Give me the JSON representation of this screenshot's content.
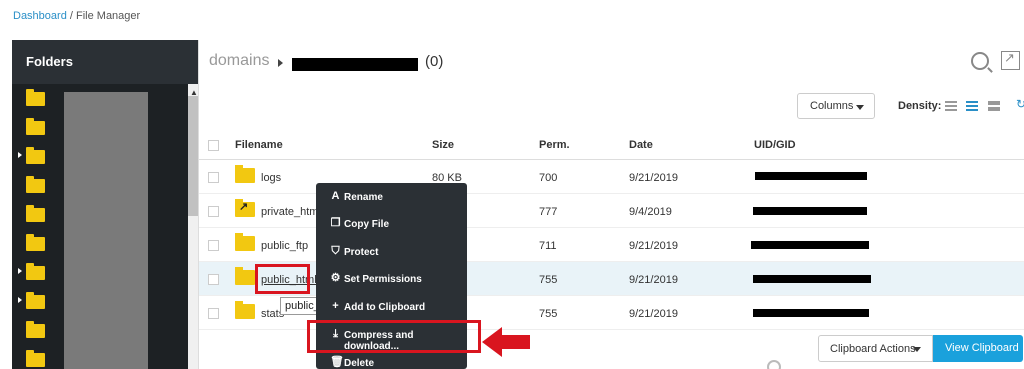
{
  "breadcrumb": {
    "home": "Dashboard",
    "separator": " / ",
    "current": "File Manager"
  },
  "sidebar": {
    "title": "Folders"
  },
  "path": {
    "root": "domains",
    "count": "(0)"
  },
  "toolbar": {
    "columns_label": "Columns",
    "density_label": "Density:"
  },
  "table": {
    "headers": {
      "filename": "Filename",
      "size": "Size",
      "perm": "Perm.",
      "date": "Date",
      "uid": "UID/GID"
    },
    "rows": [
      {
        "name": "logs",
        "size": "80 KB",
        "perm": "700",
        "date": "9/21/2019"
      },
      {
        "name": "private_html",
        "size": "",
        "perm": "777",
        "date": "9/4/2019"
      },
      {
        "name": "public_ftp",
        "size": "",
        "perm": "711",
        "date": "9/21/2019"
      },
      {
        "name": "public_html",
        "size": "",
        "perm": "755",
        "date": "9/21/2019"
      },
      {
        "name": "stats",
        "size": "",
        "perm": "755",
        "date": "9/21/2019"
      }
    ]
  },
  "tooltip": "public_html",
  "context_menu": {
    "items": [
      {
        "label": "Rename",
        "icon": "A"
      },
      {
        "label": "Copy File",
        "icon": "❐"
      },
      {
        "label": "Protect",
        "icon": "⛉"
      },
      {
        "label": "Set Permissions",
        "icon": "⚙"
      },
      {
        "label": "Add to Clipboard",
        "icon": "+"
      },
      {
        "label": "Compress and download...",
        "icon": "⤓"
      },
      {
        "label": "Delete",
        "icon": "🗑"
      }
    ]
  },
  "footer": {
    "clipboard_actions": "Clipboard Actions",
    "view_clipboard": "View Clipboard"
  },
  "colors": {
    "accent": "#2a8fc7",
    "highlight": "#d9151f",
    "folder": "#f2c811",
    "menu_bg": "#2b3035"
  }
}
